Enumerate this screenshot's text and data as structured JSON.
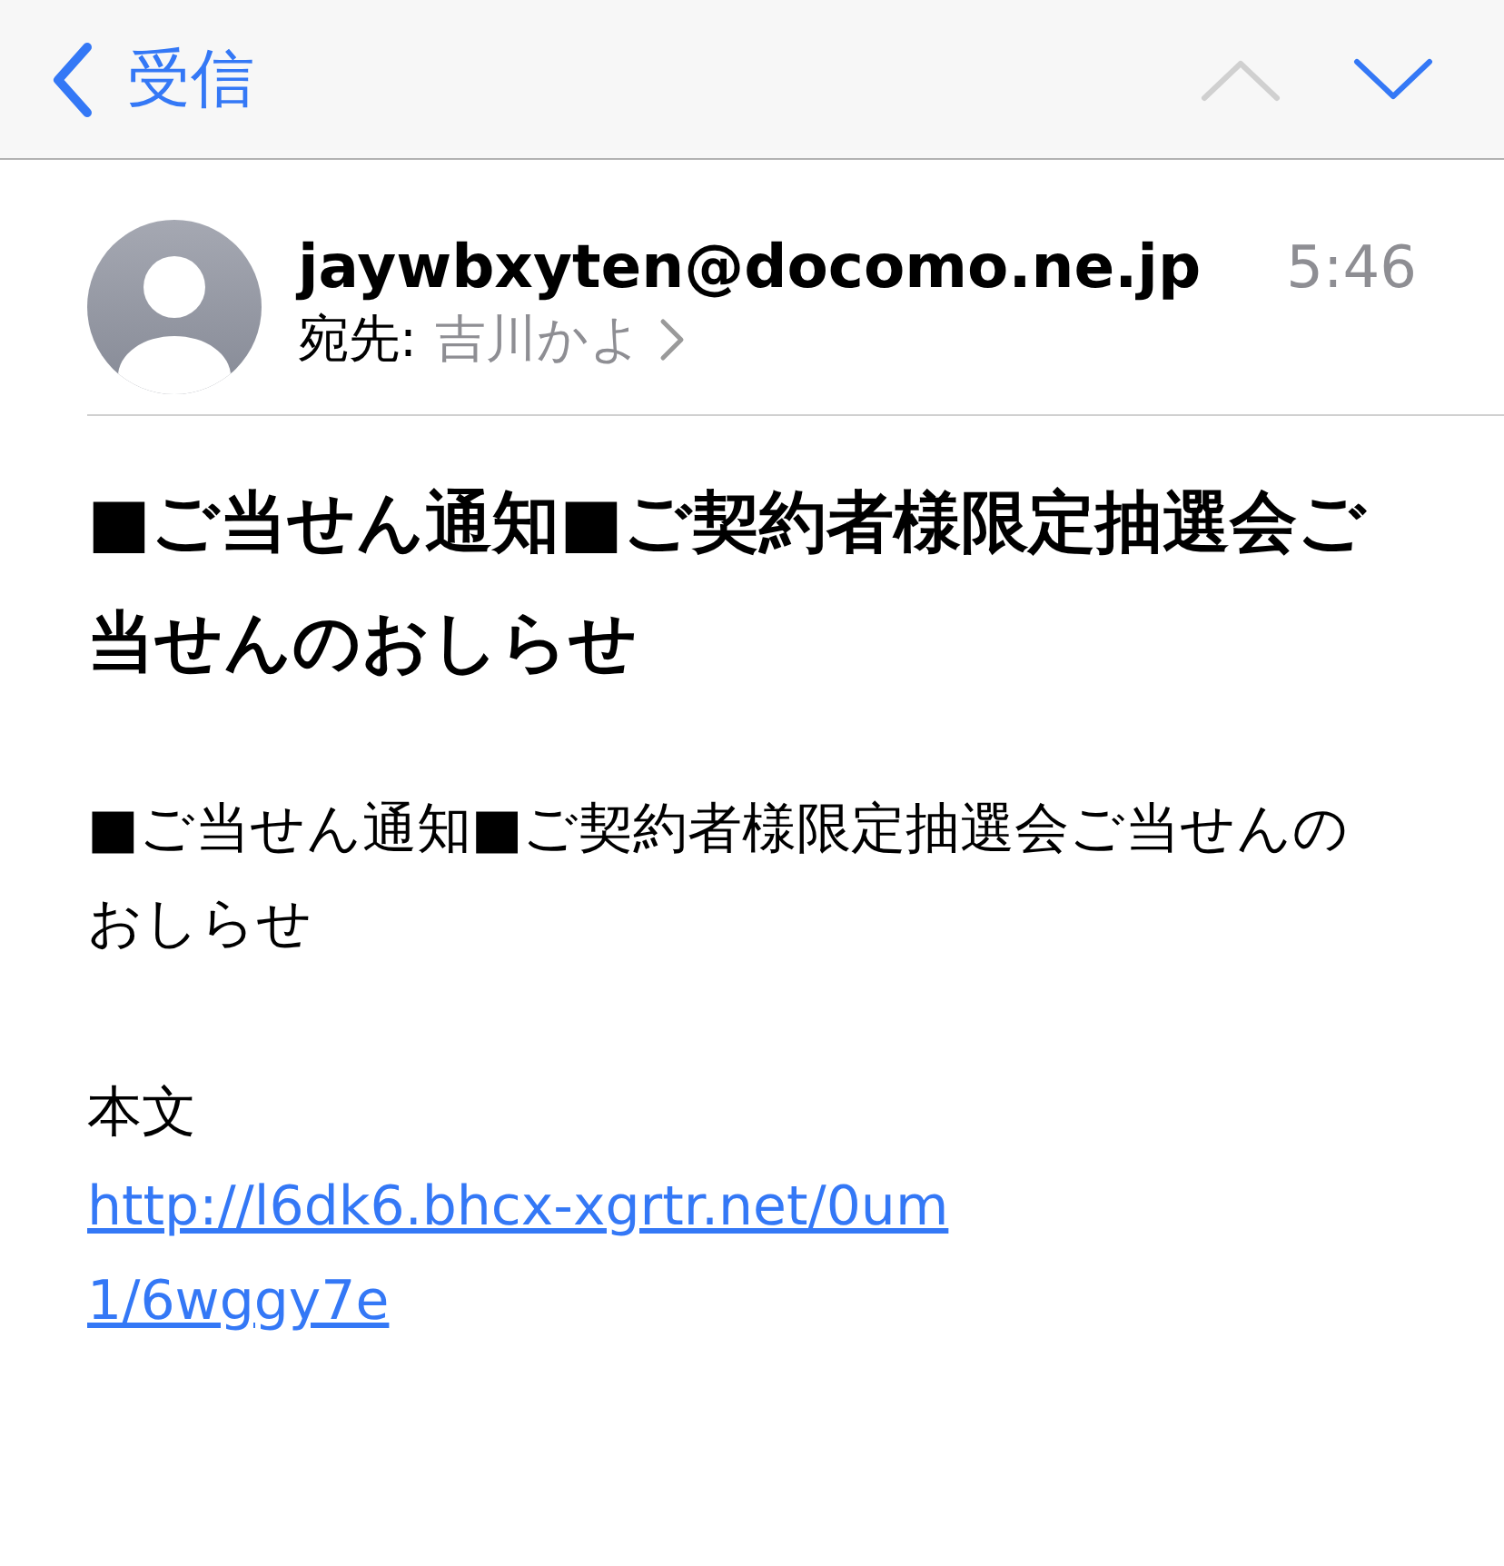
{
  "nav": {
    "back_label": "受信",
    "previous_disabled": true,
    "next_disabled": false
  },
  "message": {
    "from": "jaywbxyten@docomo.ne.jp",
    "time": "5:46",
    "to_label": "宛先:",
    "to_name": "吉川かよ"
  },
  "subject": "■ご当せん通知■ご契約者様限定抽選会ご当せんのおしらせ",
  "body": [
    {
      "kind": "text",
      "text": "■ご当せん通知■ご契約者様限定抽選会ご当せんのおしらせ"
    },
    {
      "kind": "text",
      "text": "本文"
    },
    {
      "kind": "link",
      "text": "http://l6dk6.bhcx-xgrtr.net/0um1/6wggy7e"
    }
  ]
}
